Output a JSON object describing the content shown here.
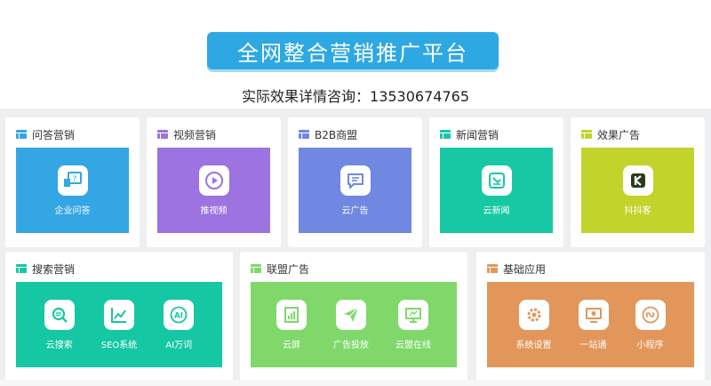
{
  "header": {
    "title": "全网整合营销推广平台",
    "subtitle_prefix": "实际效果详情咨询：",
    "subtitle_phone": "13530674765"
  },
  "colors": {
    "banner": "#2ea8e2",
    "qa": "#35a6e4",
    "video": "#9c73e0",
    "b2b": "#7088e2",
    "news": "#18c8a4",
    "effect": "#c2d32c",
    "search": "#16c7a3",
    "union": "#80d86b",
    "basic": "#e2965a"
  },
  "cards_top": [
    {
      "title": "问答营销",
      "items": [
        {
          "label": "企业问答",
          "icon": "qa-board-icon"
        }
      ]
    },
    {
      "title": "视频营销",
      "items": [
        {
          "label": "推视频",
          "icon": "play-icon"
        }
      ]
    },
    {
      "title": "B2B商盟",
      "items": [
        {
          "label": "云广告",
          "icon": "chat-bubble-icon"
        }
      ]
    },
    {
      "title": "新闻营销",
      "items": [
        {
          "label": "云新闻",
          "icon": "news-icon"
        }
      ]
    },
    {
      "title": "效果广告",
      "items": [
        {
          "label": "抖抖客",
          "icon": "k-logo-icon"
        }
      ]
    }
  ],
  "cards_bottom": [
    {
      "title": "搜索营销",
      "items": [
        {
          "label": "云搜索",
          "icon": "search-icon"
        },
        {
          "label": "SEO系统",
          "icon": "line-chart-icon"
        },
        {
          "label": "AI万词",
          "icon": "ai-icon"
        }
      ]
    },
    {
      "title": "联盟广告",
      "items": [
        {
          "label": "云屏",
          "icon": "bar-screen-icon"
        },
        {
          "label": "广告投放",
          "icon": "paper-plane-icon"
        },
        {
          "label": "云盟在线",
          "icon": "monitor-icon"
        }
      ]
    },
    {
      "title": "基础应用",
      "items": [
        {
          "label": "系统设置",
          "icon": "gear-icon"
        },
        {
          "label": "一站通",
          "icon": "display-icon"
        },
        {
          "label": "小程序",
          "icon": "mini-program-icon"
        }
      ]
    }
  ]
}
